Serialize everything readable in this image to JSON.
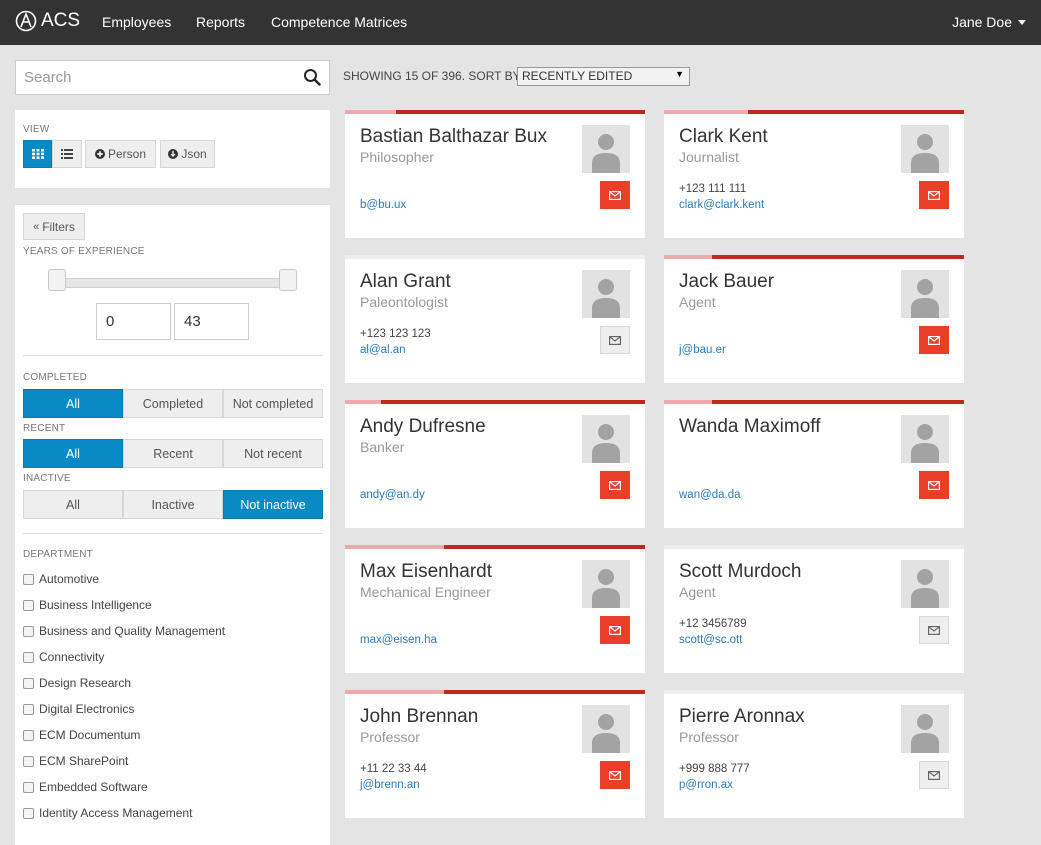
{
  "nav": {
    "brand": "ACS",
    "links": [
      "Employees",
      "Reports",
      "Competence Matrices"
    ],
    "user": "Jane Doe"
  },
  "search": {
    "placeholder": "Search",
    "value": ""
  },
  "view": {
    "label": "VIEW",
    "person_button": "Person",
    "json_button": "Json",
    "icons": [
      "grid-icon",
      "list-icon",
      "plus-circle-icon",
      "arrow-circle-icon"
    ]
  },
  "filters": {
    "button": "Filters",
    "years_label": "YEARS OF EXPERIENCE",
    "years_min": "0",
    "years_max": "43",
    "completed": {
      "label": "COMPLETED",
      "options": [
        "All",
        "Completed",
        "Not completed"
      ],
      "selected": "All"
    },
    "recent": {
      "label": "RECENT",
      "options": [
        "All",
        "Recent",
        "Not recent"
      ],
      "selected": "All"
    },
    "inactive": {
      "label": "INACTIVE",
      "options": [
        "All",
        "Inactive",
        "Not inactive"
      ],
      "selected": "Not inactive"
    },
    "department_label": "DEPARTMENT",
    "departments": [
      "Automotive",
      "Business Intelligence",
      "Business and Quality Management",
      "Connectivity",
      "Design Research",
      "Digital Electronics",
      "ECM Documentum",
      "ECM SharePoint",
      "Embedded Software",
      "Identity Access Management"
    ]
  },
  "results": {
    "showing_text": "SHOWING 15 OF 396. SORT BY",
    "sort_selected": "RECENTLY EDITED"
  },
  "colors": {
    "accent": "#0a8ac4",
    "progress": "#c0281c",
    "progress_light": "#eeaaaa",
    "mail": "#ea3e2a"
  },
  "cards": [
    {
      "name": "Bastian Balthazar Bux",
      "title": "Philosopher",
      "phone": "",
      "email": "b@bu.ux",
      "mail_active": true,
      "progress": 0.17
    },
    {
      "name": "Clark Kent",
      "title": "Journalist",
      "phone": "+123 111 111",
      "email": "clark@clark.kent",
      "mail_active": true,
      "progress": 0.28
    },
    {
      "name": "Alan Grant",
      "title": "Paleontologist",
      "phone": "+123 123 123",
      "email": "al@al.an",
      "mail_active": false,
      "progress": 0.0
    },
    {
      "name": "Jack Bauer",
      "title": "Agent",
      "phone": "",
      "email": "j@bau.er",
      "mail_active": true,
      "progress": 0.16
    },
    {
      "name": "Andy Dufresne",
      "title": "Banker",
      "phone": "",
      "email": "andy@an.dy",
      "mail_active": true,
      "progress": 0.12
    },
    {
      "name": "Wanda Maximoff",
      "title": "",
      "phone": "",
      "email": "wan@da.da",
      "mail_active": true,
      "progress": 0.16
    },
    {
      "name": "Max Eisenhardt",
      "title": "Mechanical Engineer",
      "phone": "",
      "email": "max@eisen.ha",
      "mail_active": true,
      "progress": 0.33
    },
    {
      "name": "Scott Murdoch",
      "title": "Agent",
      "phone": "+12 3456789",
      "email": "scott@sc.ott",
      "mail_active": false,
      "progress": 0.0
    },
    {
      "name": "John Brennan",
      "title": "Professor",
      "phone": "+11 22 33 44",
      "email": "j@brenn.an",
      "mail_active": true,
      "progress": 0.33
    },
    {
      "name": "Pierre Aronnax",
      "title": "Professor",
      "phone": "+999 888 777",
      "email": "p@rron.ax",
      "mail_active": false,
      "progress": 0.0
    }
  ]
}
